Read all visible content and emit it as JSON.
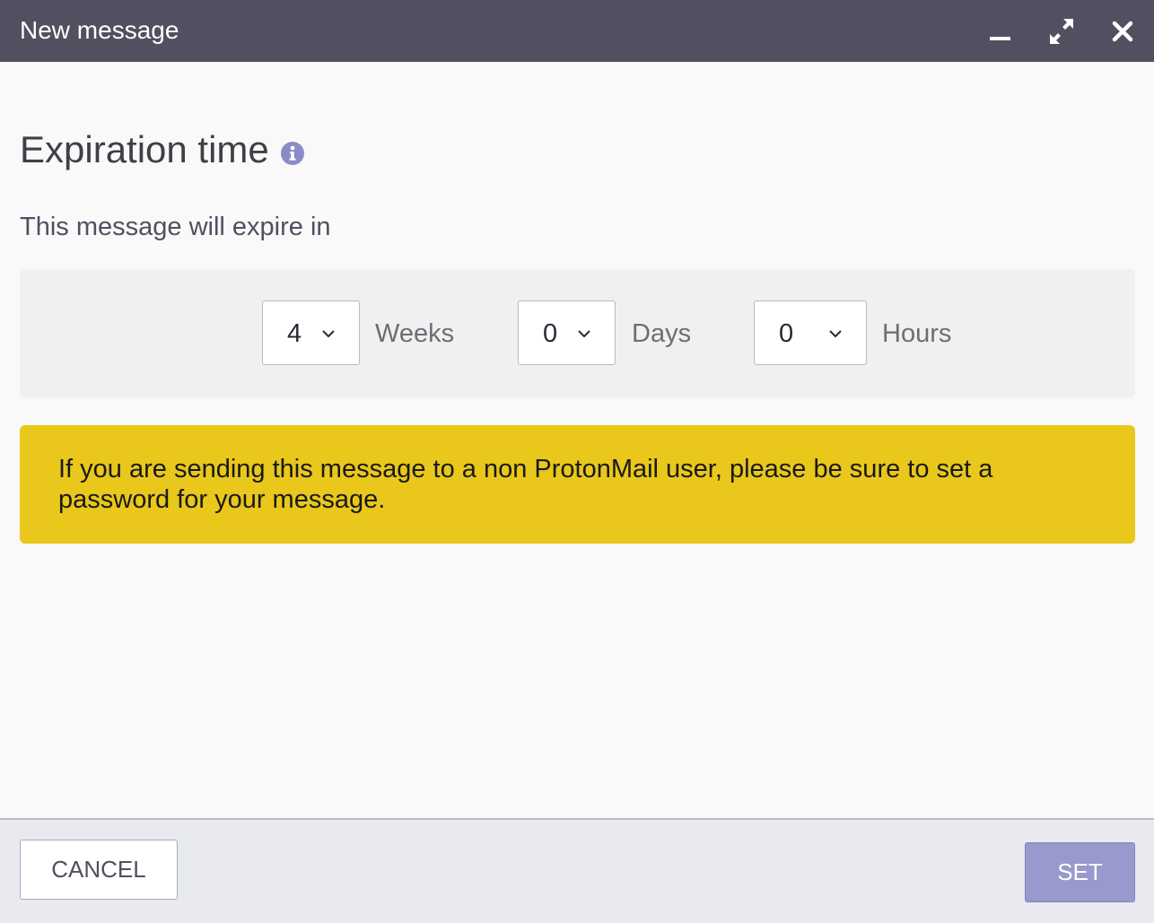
{
  "window": {
    "title": "New message",
    "controls": {
      "minimize_icon": "minimize-icon",
      "expand_icon": "expand-icon",
      "close_icon": "close-icon"
    }
  },
  "expiration": {
    "heading": "Expiration time",
    "info_icon": "info-icon",
    "intro": "This message will expire in",
    "fields": {
      "weeks": {
        "value": "4",
        "unit": "Weeks"
      },
      "days": {
        "value": "0",
        "unit": "Days"
      },
      "hours": {
        "value": "0",
        "unit": "Hours"
      }
    }
  },
  "warning": {
    "text": "If you are sending this message to a non ProtonMail user, please be sure to set a password for your message."
  },
  "footer": {
    "cancel_label": "CANCEL",
    "set_label": "SET"
  },
  "colors": {
    "titlebar": "#505061",
    "warning": "#e9c71b",
    "primary_button": "#9899cc",
    "info_icon": "#8b8bc7"
  }
}
